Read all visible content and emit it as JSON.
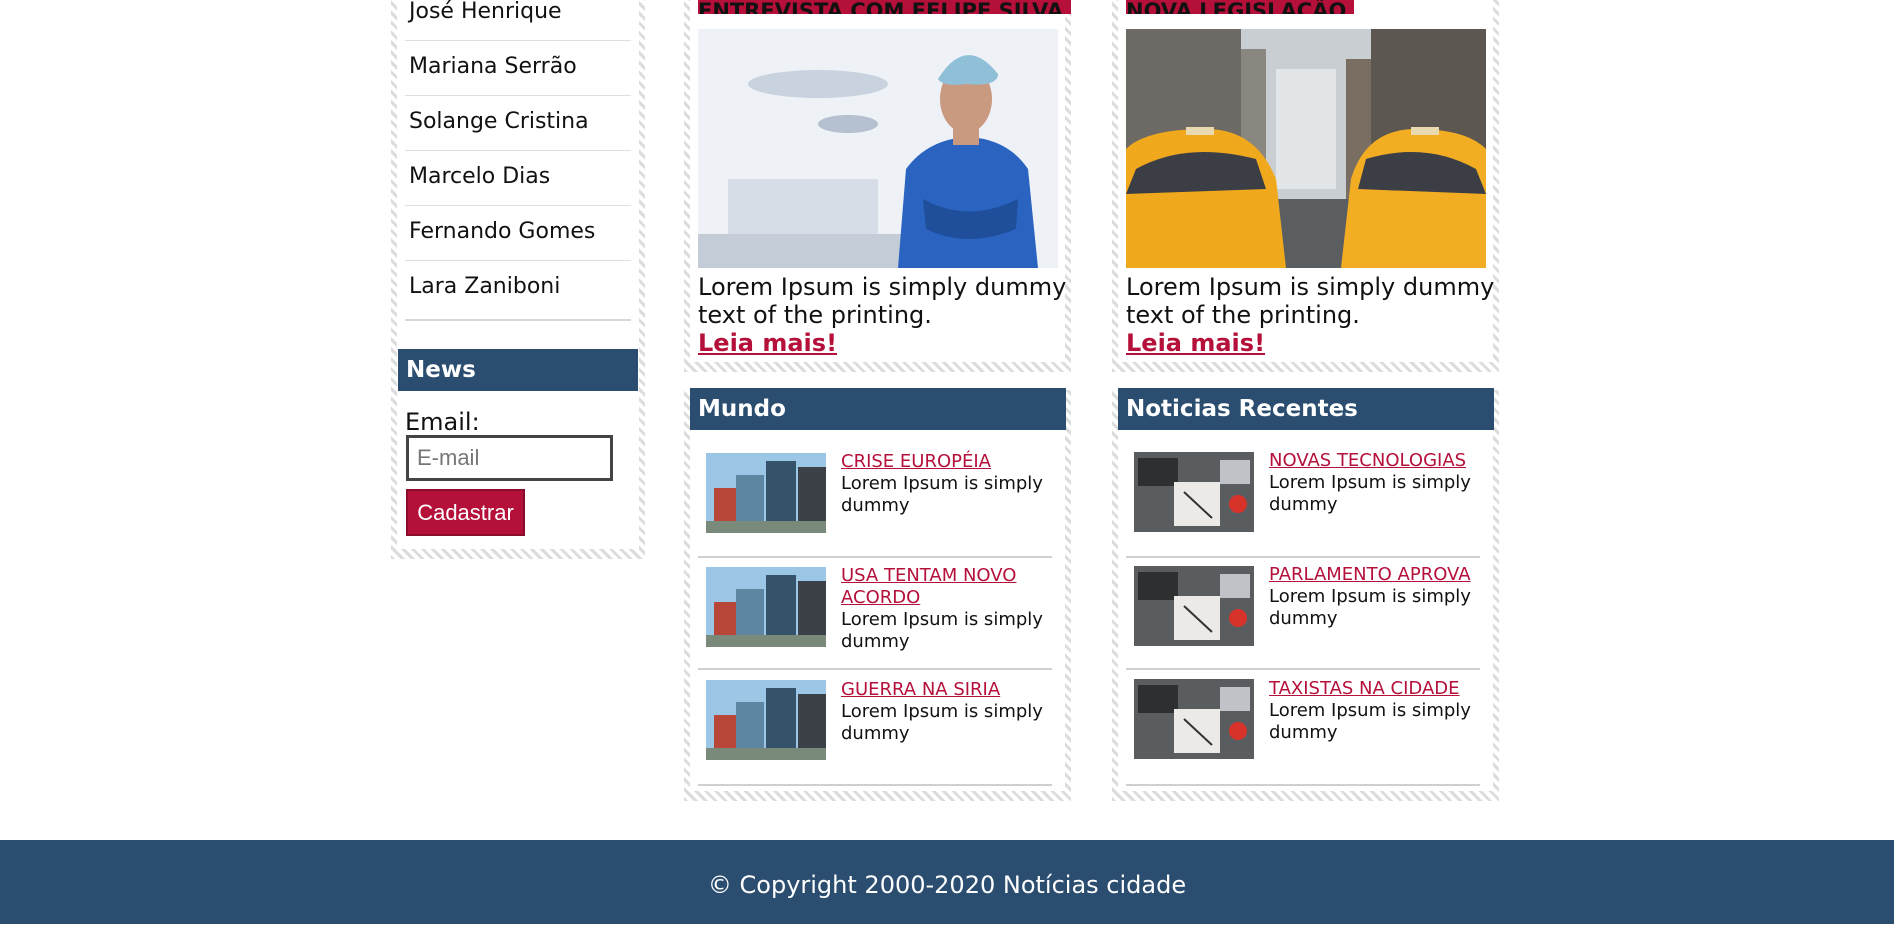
{
  "sidebar": {
    "authors": [
      "José Henrique",
      "Mariana Serrão",
      "Solange Cristina",
      "Marcelo Dias",
      "Fernando Gomes",
      "Lara Zaniboni"
    ],
    "news_title": "News",
    "email_label": "Email:",
    "email_placeholder": "E-mail",
    "submit_label": "Cadastrar"
  },
  "features": [
    {
      "title": "ENTREVISTA COM FELIPE SILVA",
      "image": "doctor-photo",
      "text": "Lorem Ipsum is simply dummy text of the printing.",
      "link": "Leia mais!"
    },
    {
      "title": "NOVA LEGISLAÇÃO",
      "image": "city-taxis-photo",
      "text": "Lorem Ipsum is simply dummy text of the printing.",
      "link": "Leia mais!"
    }
  ],
  "mundo": {
    "title": "Mundo",
    "items": [
      {
        "title": "CRISE EUROPÉIA",
        "text": "Lorem Ipsum is simply dummy"
      },
      {
        "title": "USA TENTAM NOVO ACORDO",
        "text": "Lorem Ipsum is simply dummy"
      },
      {
        "title": "GUERRA NA SIRIA",
        "text": "Lorem Ipsum is simply dummy"
      }
    ]
  },
  "recentes": {
    "title": "Noticias Recentes",
    "items": [
      {
        "title": "NOVAS TECNOLOGIAS",
        "text": "Lorem Ipsum is simply dummy"
      },
      {
        "title": "PARLAMENTO APROVA",
        "text": "Lorem Ipsum is simply dummy"
      },
      {
        "title": "TAXISTAS NA CIDADE",
        "text": "Lorem Ipsum is simply dummy"
      }
    ]
  },
  "footer": {
    "copyright": "© Copyright 2000-2020 Notícias cidade"
  },
  "colors": {
    "primary": "#2a4d70",
    "accent": "#b5103a"
  }
}
